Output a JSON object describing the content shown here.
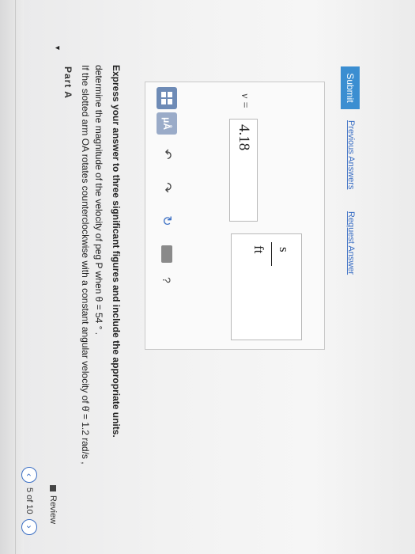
{
  "navigation": {
    "prev_icon": "‹",
    "next_icon": "›",
    "pager_text": "5 of 10"
  },
  "review": {
    "label": "Review",
    "icon": "square-icon"
  },
  "part": {
    "caret": "▼",
    "title": "Part A"
  },
  "question": {
    "line1": "If the slotted arm OA rotates counterclockwise with a constant angular velocity of θ̇ = 1.2 rad/s ,",
    "line2": "determine the magnitude of the velocity of peg P when θ = 54 ° .",
    "line3": "Express your answer to three significant figures and include the appropriate units."
  },
  "toolbar": {
    "templates_icon": "template-grid-icon",
    "units_label": "μÅ",
    "undo_icon": "undo-icon",
    "redo_icon": "redo-icon",
    "reset_icon": "reset-icon",
    "keyboard_icon": "keyboard-icon",
    "help_label": "?"
  },
  "answer": {
    "variable_label": "v =",
    "value": "4.18",
    "unit_numerator": "ft",
    "unit_denominator": "s"
  },
  "actions": {
    "submit_label": "Submit",
    "previous_answers_label": "Previous Answers",
    "request_answer_label": "Request Answer"
  },
  "colors": {
    "accent": "#3b8ed1",
    "link": "#3b6fc4",
    "toolbar_primary": "#6e8bb6",
    "toolbar_secondary": "#9aabc8"
  }
}
